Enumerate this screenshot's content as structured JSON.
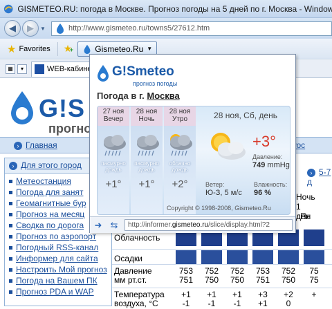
{
  "window": {
    "title": "GISMETEO.RU: погода в Москве. Прогноз погоды на 5 дней по г. Москва - Windows Internet"
  },
  "address": {
    "url": "http://www.gismeteo.ru/towns5/27612.htm"
  },
  "favorites": {
    "label": "Favorites",
    "gismeteo_button": "Gismeteo.Ru"
  },
  "tab": {
    "label": "WEB-кабинет"
  },
  "page": {
    "gis": "G!S",
    "prognoz": "прогноз",
    "nav": [
      "Главная",
      "Рос",
      "5-7 д"
    ],
    "sidebar_head": "Для этого город",
    "sidebar_items": [
      "Метеостанция",
      "Погода для занят",
      "Геомагнитные бур",
      "Прогноз на месяц",
      "Сводка по дорога",
      "Прогноз по аэропорт",
      "Погодный RSS-канал",
      "Информер для сайта",
      "Настроить Мой прогноз",
      "Погода на Вашем ПК",
      "Прогноз PDA и WAP"
    ],
    "right_head": [
      "Ночь",
      "1 дек",
      "Пн"
    ],
    "rows": {
      "oblachnost": "Облачность",
      "osadki": "Осадки",
      "davlenie_1": "Давление",
      "davlenie_2": "мм рт.ст.",
      "temp_1": "Температура",
      "temp_2": "воздуха, °C"
    },
    "pressure_top": [
      "753",
      "752",
      "752",
      "753",
      "752",
      "75"
    ],
    "pressure_bot": [
      "751",
      "750",
      "750",
      "751",
      "750",
      "75"
    ],
    "temp_top": [
      "+1",
      "+1",
      "+1",
      "+3",
      "+2",
      "+"
    ],
    "temp_bot": [
      "-1",
      "-1",
      "-1",
      "+1",
      "0",
      ""
    ]
  },
  "informer": {
    "brand": "G!Smeteo",
    "brand_g": "G!S",
    "brand_rest": "meteo",
    "brand_sub": "прогноз погоды",
    "pogoda_prefix": "Погода в г.",
    "city": "Москва",
    "periods": [
      {
        "date": "27 ноя",
        "time": "Вечер",
        "cond_1": "пасмурно",
        "cond_2": "дождь",
        "temp": "+1°"
      },
      {
        "date": "28 ноя",
        "time": "Ночь",
        "cond_1": "пасмурно",
        "cond_2": "дождь",
        "temp": "+1°"
      },
      {
        "date": "28 ноя",
        "time": "Утро",
        "cond_1": "облачно",
        "cond_2": "дождь",
        "temp": "+2°"
      }
    ],
    "today": {
      "date": "28 ноя, Сб, день",
      "temp": "+3°",
      "pressure_label": "Давление:",
      "pressure_value": "749",
      "pressure_unit": "mmHg",
      "wind_label": "Ветер:",
      "wind_value": "Ю-З, 5 м/с",
      "humidity_label": "Влажность:",
      "humidity_value": "96 %"
    },
    "copyright": "Copyright © 1998-2008, Gismeteo.Ru",
    "footer_url_prefix": "http://informer.",
    "footer_url_host": "gismeteo.ru",
    "footer_url_suffix": "/slice/display.html?2"
  },
  "colors": {
    "accent": "#1b5aa8",
    "hot": "#d83a2a",
    "period_header": "#e8d6e6"
  }
}
